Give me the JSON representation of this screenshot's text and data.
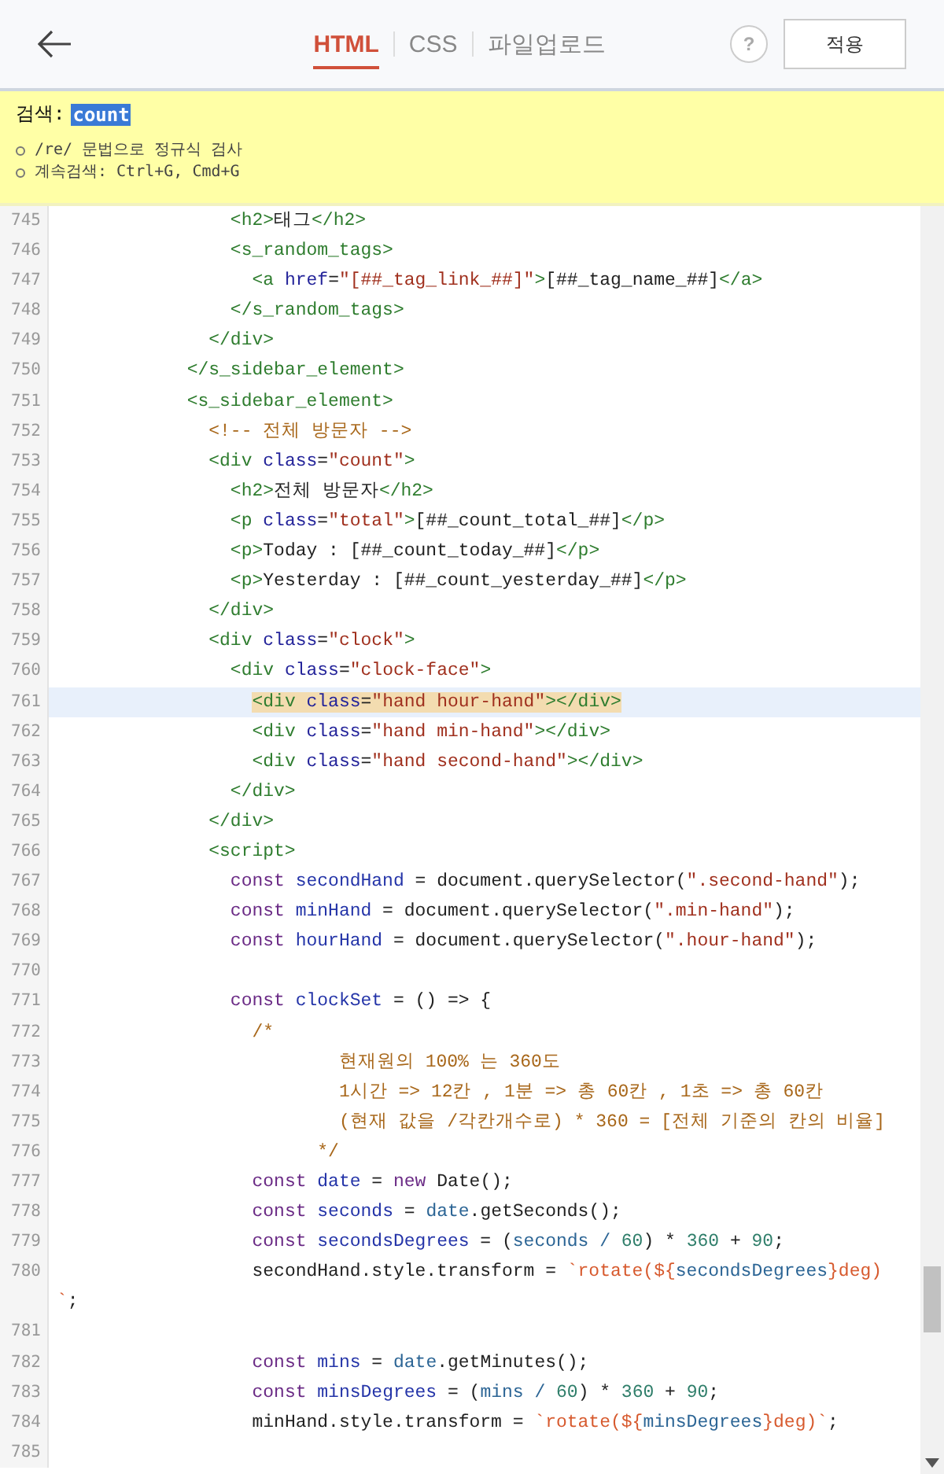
{
  "header": {
    "tabs": [
      {
        "label": "HTML",
        "selected": true
      },
      {
        "label": "CSS",
        "selected": false
      },
      {
        "label": "파일업로드",
        "selected": false
      }
    ],
    "help": "?",
    "apply": "적용"
  },
  "search": {
    "label": "검색:",
    "value": "count",
    "hints": [
      "/re/ 문법으로 정규식 검사",
      "계속검색: Ctrl+G, Cmd+G"
    ]
  },
  "lines": [
    {
      "number": "745",
      "current": false,
      "tokens": [
        {
          "kind": "tag",
          "text": "                <h2>"
        },
        {
          "kind": "plain",
          "text": "태그"
        },
        {
          "kind": "tag",
          "text": "</h2>"
        }
      ]
    },
    {
      "number": "746",
      "current": false,
      "tokens": [
        {
          "kind": "tag",
          "text": "                <s_random_tags>"
        }
      ]
    },
    {
      "number": "747",
      "current": false,
      "tokens": [
        {
          "kind": "tag",
          "text": "                  <a "
        },
        {
          "kind": "attr",
          "text": "href"
        },
        {
          "kind": "plain",
          "text": "="
        },
        {
          "kind": "str",
          "text": "\"[##_tag_link_##]\""
        },
        {
          "kind": "tag",
          "text": ">"
        },
        {
          "kind": "plain",
          "text": "[##_tag_name_##]"
        },
        {
          "kind": "tag",
          "text": "</a>"
        }
      ]
    },
    {
      "number": "748",
      "current": false,
      "tokens": [
        {
          "kind": "tag",
          "text": "                </s_random_tags>"
        }
      ]
    },
    {
      "number": "749",
      "current": false,
      "tokens": [
        {
          "kind": "tag",
          "text": "              </div>"
        }
      ]
    },
    {
      "number": "750",
      "current": false,
      "tokens": [
        {
          "kind": "tag",
          "text": "            </s_sidebar_element>"
        }
      ]
    },
    {
      "number": "751",
      "current": false,
      "tokens": [
        {
          "kind": "tag",
          "text": "            <s_sidebar_element>"
        }
      ]
    },
    {
      "number": "752",
      "current": false,
      "tokens": [
        {
          "kind": "comment",
          "text": "              <!-- 전체 방문자 -->"
        }
      ]
    },
    {
      "number": "753",
      "current": false,
      "tokens": [
        {
          "kind": "tag",
          "text": "              <div "
        },
        {
          "kind": "attr",
          "text": "class"
        },
        {
          "kind": "plain",
          "text": "="
        },
        {
          "kind": "str",
          "text": "\"count\""
        },
        {
          "kind": "tag",
          "text": ">"
        }
      ]
    },
    {
      "number": "754",
      "current": false,
      "tokens": [
        {
          "kind": "tag",
          "text": "                <h2>"
        },
        {
          "kind": "plain",
          "text": "전체 방문자"
        },
        {
          "kind": "tag",
          "text": "</h2>"
        }
      ]
    },
    {
      "number": "755",
      "current": false,
      "tokens": [
        {
          "kind": "tag",
          "text": "                <p "
        },
        {
          "kind": "attr",
          "text": "class"
        },
        {
          "kind": "plain",
          "text": "="
        },
        {
          "kind": "str",
          "text": "\"total\""
        },
        {
          "kind": "tag",
          "text": ">"
        },
        {
          "kind": "plain",
          "text": "[##_count_total_##]"
        },
        {
          "kind": "tag",
          "text": "</p>"
        }
      ]
    },
    {
      "number": "756",
      "current": false,
      "tokens": [
        {
          "kind": "tag",
          "text": "                <p>"
        },
        {
          "kind": "plain",
          "text": "Today : [##_count_today_##]"
        },
        {
          "kind": "tag",
          "text": "</p>"
        }
      ]
    },
    {
      "number": "757",
      "current": false,
      "tokens": [
        {
          "kind": "tag",
          "text": "                <p>"
        },
        {
          "kind": "plain",
          "text": "Yesterday : [##_count_yesterday_##]"
        },
        {
          "kind": "tag",
          "text": "</p>"
        }
      ]
    },
    {
      "number": "758",
      "current": false,
      "tokens": [
        {
          "kind": "tag",
          "text": "              </div>"
        }
      ]
    },
    {
      "number": "759",
      "current": false,
      "tokens": [
        {
          "kind": "tag",
          "text": "              <div "
        },
        {
          "kind": "attr",
          "text": "class"
        },
        {
          "kind": "plain",
          "text": "="
        },
        {
          "kind": "str",
          "text": "\"clock\""
        },
        {
          "kind": "tag",
          "text": ">"
        }
      ]
    },
    {
      "number": "760",
      "current": false,
      "tokens": [
        {
          "kind": "tag",
          "text": "                <div "
        },
        {
          "kind": "attr",
          "text": "class"
        },
        {
          "kind": "plain",
          "text": "="
        },
        {
          "kind": "str",
          "text": "\"clock-face\""
        },
        {
          "kind": "tag",
          "text": ">"
        }
      ]
    },
    {
      "number": "761",
      "current": true,
      "tokens": [
        {
          "kind": "tag",
          "text": "                  <div "
        },
        {
          "kind": "attr",
          "text": "class"
        },
        {
          "kind": "plain",
          "text": "="
        },
        {
          "kind": "str",
          "text": "\"hand hour-hand\""
        },
        {
          "kind": "tag",
          "text": "></div>"
        }
      ]
    },
    {
      "number": "762",
      "current": false,
      "tokens": [
        {
          "kind": "tag",
          "text": "                  <div "
        },
        {
          "kind": "attr",
          "text": "class"
        },
        {
          "kind": "plain",
          "text": "="
        },
        {
          "kind": "str",
          "text": "\"hand min-hand\""
        },
        {
          "kind": "tag",
          "text": "></div>"
        }
      ]
    },
    {
      "number": "763",
      "current": false,
      "tokens": [
        {
          "kind": "tag",
          "text": "                  <div "
        },
        {
          "kind": "attr",
          "text": "class"
        },
        {
          "kind": "plain",
          "text": "="
        },
        {
          "kind": "str",
          "text": "\"hand second-hand\""
        },
        {
          "kind": "tag",
          "text": "></div>"
        }
      ]
    },
    {
      "number": "764",
      "current": false,
      "tokens": [
        {
          "kind": "tag",
          "text": "                </div>"
        }
      ]
    },
    {
      "number": "765",
      "current": false,
      "tokens": [
        {
          "kind": "tag",
          "text": "              </div>"
        }
      ]
    },
    {
      "number": "766",
      "current": false,
      "tokens": [
        {
          "kind": "tag",
          "text": "              <script>"
        }
      ]
    },
    {
      "number": "767",
      "current": false,
      "tokens": [
        {
          "kind": "kw",
          "text": "                const "
        },
        {
          "kind": "var",
          "text": "secondHand"
        },
        {
          "kind": "plain",
          "text": " = document.querySelector("
        },
        {
          "kind": "str",
          "text": "\".second-hand\""
        },
        {
          "kind": "plain",
          "text": ");"
        }
      ]
    },
    {
      "number": "768",
      "current": false,
      "tokens": [
        {
          "kind": "kw",
          "text": "                const "
        },
        {
          "kind": "var",
          "text": "minHand"
        },
        {
          "kind": "plain",
          "text": " = document.querySelector("
        },
        {
          "kind": "str",
          "text": "\".min-hand\""
        },
        {
          "kind": "plain",
          "text": ");"
        }
      ]
    },
    {
      "number": "769",
      "current": false,
      "tokens": [
        {
          "kind": "kw",
          "text": "                const "
        },
        {
          "kind": "var",
          "text": "hourHand"
        },
        {
          "kind": "plain",
          "text": " = document.querySelector("
        },
        {
          "kind": "str",
          "text": "\".hour-hand\""
        },
        {
          "kind": "plain",
          "text": ");"
        }
      ]
    },
    {
      "number": "770",
      "current": false
    },
    {
      "number": "771",
      "current": false,
      "tokens": [
        {
          "kind": "kw",
          "text": "                const "
        },
        {
          "kind": "var",
          "text": "clockSet"
        },
        {
          "kind": "plain",
          "text": " = () => {"
        }
      ]
    },
    {
      "number": "772",
      "current": false,
      "tokens": [
        {
          "kind": "comment",
          "text": "                  /*"
        }
      ]
    },
    {
      "number": "773",
      "current": false,
      "tokens": [
        {
          "kind": "comment",
          "text": "                          현재원의 100% 는 360도"
        }
      ]
    },
    {
      "number": "774",
      "current": false,
      "tokens": [
        {
          "kind": "comment",
          "text": "                          1시간 => 12칸 , 1분 => 총 60칸 , 1초 => 총 60칸"
        }
      ]
    },
    {
      "number": "775",
      "current": false,
      "tokens": [
        {
          "kind": "comment",
          "text": "                          (현재 값을 /각칸개수로) * 360 = [전체 기준의 칸의 비율]"
        }
      ]
    },
    {
      "number": "776",
      "current": false,
      "tokens": [
        {
          "kind": "comment",
          "text": "                        */"
        }
      ]
    },
    {
      "number": "777",
      "current": false,
      "tokens": [
        {
          "kind": "kw",
          "text": "                  const "
        },
        {
          "kind": "var",
          "text": "date"
        },
        {
          "kind": "plain",
          "text": " = "
        },
        {
          "kind": "kw",
          "text": "new"
        },
        {
          "kind": "plain",
          "text": " Date();"
        }
      ]
    },
    {
      "number": "778",
      "current": false,
      "tokens": [
        {
          "kind": "kw",
          "text": "                  const "
        },
        {
          "kind": "var",
          "text": "seconds"
        },
        {
          "kind": "plain",
          "text": " = "
        },
        {
          "kind": "ref",
          "text": "date"
        },
        {
          "kind": "plain",
          "text": ".getSeconds();"
        }
      ]
    },
    {
      "number": "779",
      "current": false,
      "tokens": [
        {
          "kind": "kw",
          "text": "                  const "
        },
        {
          "kind": "var",
          "text": "secondsDegrees"
        },
        {
          "kind": "plain",
          "text": " = ("
        },
        {
          "kind": "ref",
          "text": "seconds / "
        },
        {
          "kind": "num",
          "text": "60"
        },
        {
          "kind": "plain",
          "text": ") * "
        },
        {
          "kind": "num",
          "text": "360"
        },
        {
          "kind": "plain",
          "text": " + "
        },
        {
          "kind": "num",
          "text": "90"
        },
        {
          "kind": "plain",
          "text": ";"
        }
      ]
    },
    {
      "number": "780",
      "current": false,
      "tokens": [
        {
          "kind": "plain",
          "text": "                  secondHand.style.transform = "
        },
        {
          "kind": "tmpl",
          "text": "`rotate(${"
        },
        {
          "kind": "ref",
          "text": "secondsDegrees"
        },
        {
          "kind": "tmpl",
          "text": "}deg)`"
        },
        {
          "kind": "plain",
          "text": ";"
        }
      ]
    },
    {
      "number": "781",
      "current": false
    },
    {
      "number": "782",
      "current": false,
      "tokens": [
        {
          "kind": "kw",
          "text": "                  const "
        },
        {
          "kind": "var",
          "text": "mins"
        },
        {
          "kind": "plain",
          "text": " = "
        },
        {
          "kind": "ref",
          "text": "date"
        },
        {
          "kind": "plain",
          "text": ".getMinutes();"
        }
      ]
    },
    {
      "number": "783",
      "current": false,
      "tokens": [
        {
          "kind": "kw",
          "text": "                  const "
        },
        {
          "kind": "var",
          "text": "minsDegrees"
        },
        {
          "kind": "plain",
          "text": " = ("
        },
        {
          "kind": "ref",
          "text": "mins / "
        },
        {
          "kind": "num",
          "text": "60"
        },
        {
          "kind": "plain",
          "text": ") * "
        },
        {
          "kind": "num",
          "text": "360"
        },
        {
          "kind": "plain",
          "text": " + "
        },
        {
          "kind": "num",
          "text": "90"
        },
        {
          "kind": "plain",
          "text": ";"
        }
      ]
    },
    {
      "number": "784",
      "current": false,
      "tokens": [
        {
          "kind": "plain",
          "text": "                  minHand.style.transform = "
        },
        {
          "kind": "tmpl",
          "text": "`rotate(${"
        },
        {
          "kind": "ref",
          "text": "minsDegrees"
        },
        {
          "kind": "tmpl",
          "text": "}deg)`"
        },
        {
          "kind": "plain",
          "text": ";"
        }
      ]
    },
    {
      "number": "785",
      "current": false
    }
  ]
}
